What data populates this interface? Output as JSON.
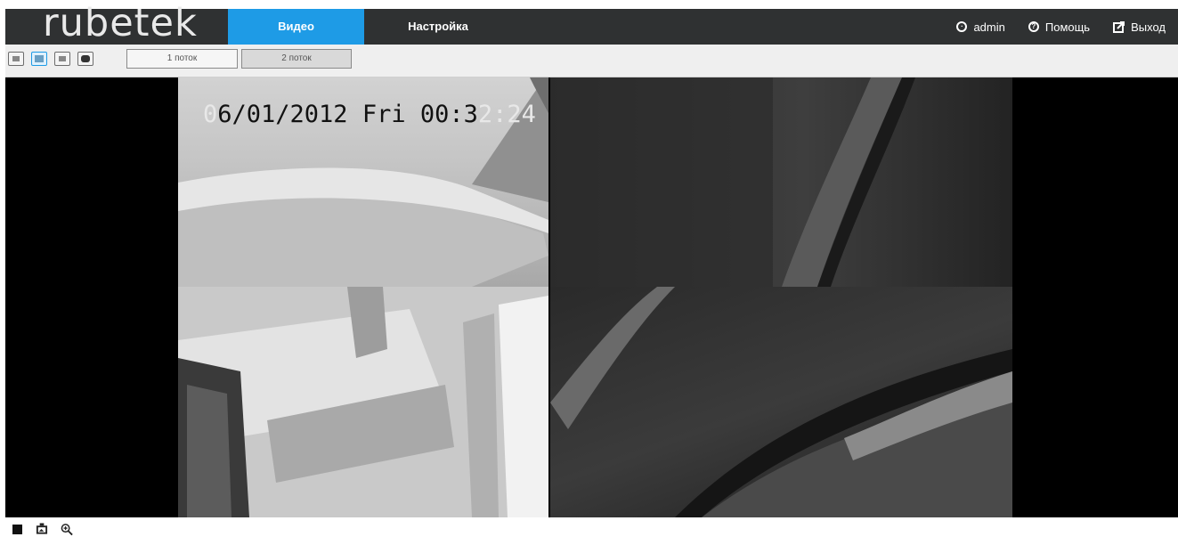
{
  "app": {
    "logo_text": "rubetek"
  },
  "nav": {
    "tabs": [
      {
        "label": "Видео",
        "active": true
      },
      {
        "label": "Настройка",
        "active": false
      }
    ],
    "user": {
      "label": "admin",
      "icon": "user-icon"
    },
    "help": {
      "label": "Помощь",
      "icon": "help-icon"
    },
    "logout": {
      "label": "Выход",
      "icon": "exit-icon"
    }
  },
  "toolbar": {
    "layouts": [
      {
        "icon": "layout-1x1-icon",
        "selected": false
      },
      {
        "icon": "layout-2x2-icon",
        "selected": true
      },
      {
        "icon": "layout-3x3-icon",
        "selected": false
      },
      {
        "icon": "layout-fullscreen-icon",
        "selected": false
      }
    ],
    "streams": [
      {
        "label": "1 поток",
        "active": false
      },
      {
        "label": "2 поток",
        "active": true
      }
    ]
  },
  "video": {
    "osd_main": "6/01/2012 Fri 00:3",
    "osd_lead": "0",
    "osd_tail": "2:24"
  },
  "bottom": {
    "icons": [
      "stop-icon",
      "snapshot-icon",
      "zoom-in-icon"
    ]
  },
  "colors": {
    "accent": "#1e9be6",
    "nav_bg": "#2f3132",
    "toolbar_bg": "#efefef"
  }
}
